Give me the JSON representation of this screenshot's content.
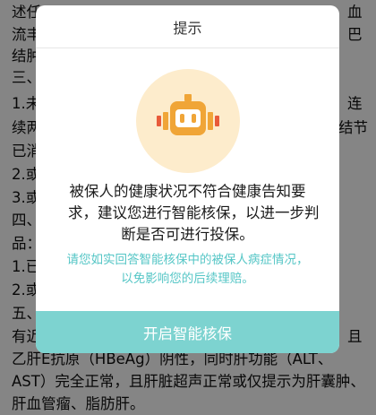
{
  "dialog": {
    "title": "提示",
    "message_line1": "被保人的健康状况不符合健康告知要",
    "message_line2": "求，建议您进行智能核保，以进一步判",
    "message_line3": "断是否可进行投保。",
    "tip_line1": "请您如实回答智能核保中的被保人病症情况，",
    "tip_line2": "以免影响您的后续理赔。",
    "button_label": "开启智能核保",
    "icon": "robot-icon",
    "accent_color": "#7dd3d0",
    "tip_color": "#55c6c6",
    "icon_bg_color": "#fdeccc",
    "icon_color": "#f0a537"
  },
  "document": {
    "line_1_left": "述任",
    "line_1_right": "血",
    "line_2_left": "流丰",
    "line_2_right": "巴",
    "line_3_left": "结肿",
    "line_4_left": "三、",
    "line_5_left": "1.未",
    "line_5_right": "连",
    "line_6_left": "续两",
    "line_6_right": "结节",
    "line_7_left": "已消",
    "line_8_left": "2.或",
    "line_9_left": "3.或",
    "line_10_left": "四、",
    "line_11_left": "品：",
    "line_12_left": "1.已",
    "line_13_left": "2.或",
    "line_14_left": "五、",
    "line_15_left": "有近",
    "line_15_right": "且",
    "line_16": "乙肝E抗原（HBeAg）阴性，同时肝功能（ALT、",
    "line_17": "AST）完全正常，且肝脏超声正常或仅提示为肝囊肿、",
    "line_18": "肝血管瘤、脂肪肝。"
  }
}
